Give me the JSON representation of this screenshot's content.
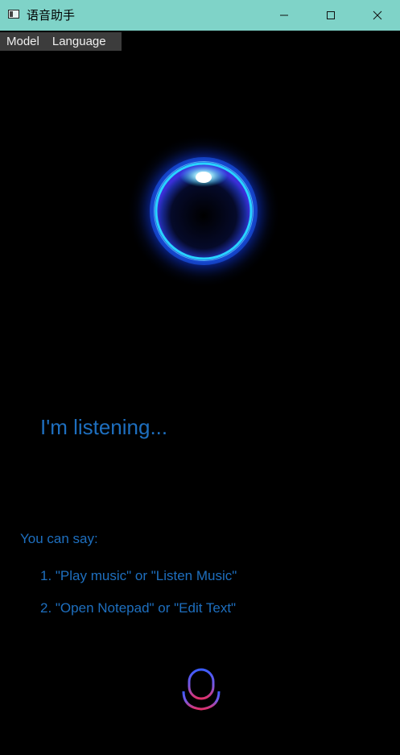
{
  "window": {
    "title": "语音助手",
    "title_bar_color": "#7fd3c8"
  },
  "window_controls": {
    "minimize_icon": "minimize-icon",
    "maximize_icon": "maximize-icon",
    "close_icon": "close-icon"
  },
  "menu": {
    "items": [
      {
        "label": "Model"
      },
      {
        "label": "Language"
      }
    ]
  },
  "status": {
    "text": "I'm listening..."
  },
  "hints": {
    "title": "You can say:",
    "items": [
      "1. \"Play music\" or \"Listen Music\"",
      "2. \"Open Notepad\" or \"Edit Text\""
    ]
  },
  "icons": {
    "orb": "listening-orb-icon",
    "mic": "microphone-icon"
  },
  "colors": {
    "text_accent": "#1e6fbf",
    "background": "#000000",
    "menu_bar": "#3c3c3c",
    "orb_glow": "#1a5cff",
    "orb_ring": "#29d3ff"
  }
}
